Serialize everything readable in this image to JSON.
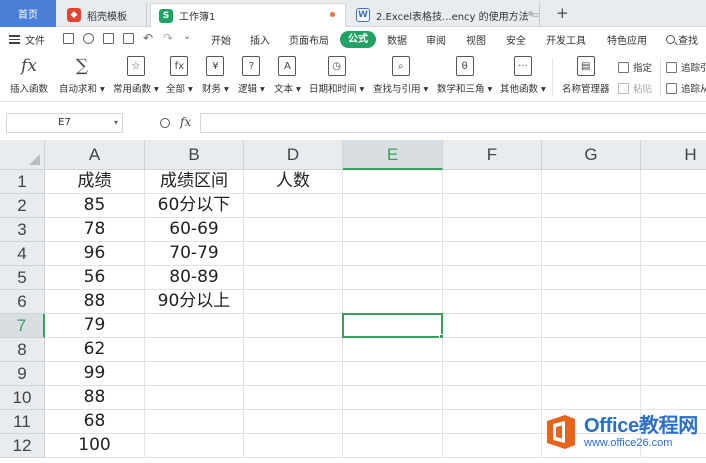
{
  "tabs": {
    "home": "首页",
    "docer": "稻壳模板",
    "book": "工作簿1",
    "article": "2.Excel表格技...ency 的使用方法",
    "add": "+"
  },
  "menu": {
    "file": "文件",
    "items": [
      "开始",
      "插入",
      "页面布局",
      "公式",
      "数据",
      "审阅",
      "视图",
      "安全",
      "开发工具",
      "特色应用"
    ],
    "search": "查找"
  },
  "ribbon": {
    "insert_function": "插入函数",
    "autosum": "自动求和",
    "common_functions": "常用函数",
    "all": "全部",
    "finance": "财务",
    "logic": "逻辑",
    "text": "文本",
    "datetime": "日期和时间",
    "lookup": "查找与引用",
    "math": "数学和三角",
    "other": "其他函数",
    "name_manager": "名称管理器",
    "define": "指定",
    "paste": "粘贴",
    "trace_precedents": "追踪引",
    "trace_dependents": "追踪从",
    "fx_glyph": "fx",
    "sum_glyph": "∑"
  },
  "formula_bar": {
    "cell_ref": "E7",
    "fx": "fx",
    "value": ""
  },
  "sheet": {
    "columns": [
      "A",
      "B",
      "D",
      "E",
      "F",
      "G",
      "H"
    ],
    "selected_column": "E",
    "selected_row": "7",
    "rows": [
      {
        "num": "1",
        "cells": [
          "成绩",
          "成绩区间",
          "人数",
          "",
          "",
          "",
          ""
        ]
      },
      {
        "num": "2",
        "cells": [
          "85",
          "60分以下",
          "",
          "",
          "",
          "",
          ""
        ]
      },
      {
        "num": "3",
        "cells": [
          "78",
          "60-69",
          "",
          "",
          "",
          "",
          ""
        ]
      },
      {
        "num": "4",
        "cells": [
          "96",
          "70-79",
          "",
          "",
          "",
          "",
          ""
        ]
      },
      {
        "num": "5",
        "cells": [
          "56",
          "80-89",
          "",
          "",
          "",
          "",
          ""
        ]
      },
      {
        "num": "6",
        "cells": [
          "88",
          "90分以上",
          "",
          "",
          "",
          "",
          ""
        ]
      },
      {
        "num": "7",
        "cells": [
          "79",
          "",
          "",
          "",
          "",
          "",
          ""
        ]
      },
      {
        "num": "8",
        "cells": [
          "62",
          "",
          "",
          "",
          "",
          "",
          ""
        ]
      },
      {
        "num": "9",
        "cells": [
          "99",
          "",
          "",
          "",
          "",
          "",
          ""
        ]
      },
      {
        "num": "10",
        "cells": [
          "88",
          "",
          "",
          "",
          "",
          "",
          ""
        ]
      },
      {
        "num": "11",
        "cells": [
          "68",
          "",
          "",
          "",
          "",
          "",
          ""
        ]
      },
      {
        "num": "12",
        "cells": [
          "100",
          "",
          "",
          "",
          "",
          "",
          ""
        ]
      }
    ]
  },
  "watermark": {
    "title": "Office教程网",
    "url": "www.office26.com"
  },
  "colors": {
    "accent_green": "#3a9e5c",
    "formula_tab": "#21a366",
    "home_tab": "#4a7fd8",
    "watermark_orange": "#e8641b",
    "watermark_blue": "#2b6fc6"
  }
}
